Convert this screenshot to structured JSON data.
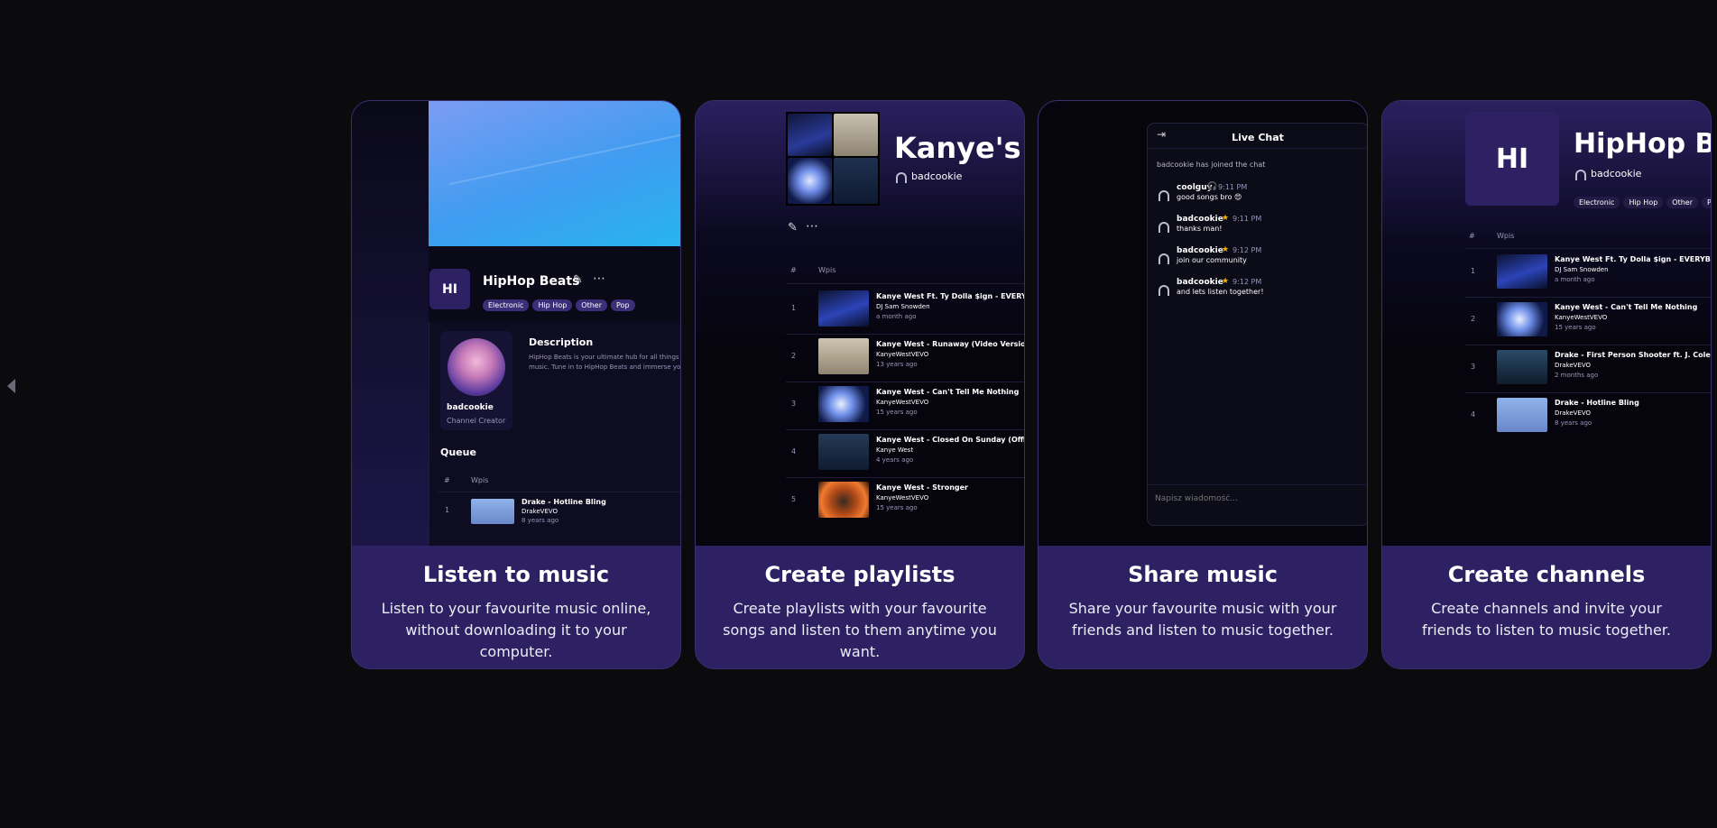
{
  "nav": {
    "prev_icon": "chevron-left-icon",
    "next_icon": "chevron-right-icon"
  },
  "cards": [
    {
      "title": "Listen to music",
      "text": "Listen to your favourite music online, without downloading it to your computer.",
      "preview": {
        "avatar_initials": "HI",
        "channel_name": "HipHop Beats",
        "tags": [
          "Electronic",
          "Hip Hop",
          "Other",
          "Pop"
        ],
        "creator_name": "badcookie",
        "creator_role": "Channel Creator",
        "description_heading": "Description",
        "description_text": "HipHop Beats is your ultimate hub for all things music. Tune in to HipHop Beats and immerse yo",
        "queue_heading": "Queue",
        "col_num": "#",
        "col_title": "Wpis",
        "queue": [
          {
            "num": "1",
            "title": "Drake - Hotline Bling",
            "artist": "DrakeVEVO",
            "age": "8 years ago"
          }
        ]
      }
    },
    {
      "title": "Create playlists",
      "text": "Create playlists with your favourite songs and listen to them anytime you want.",
      "preview": {
        "playlist_name": "Kanye's Be",
        "owner": "badcookie",
        "col_num": "#",
        "col_title": "Wpis",
        "tracks": [
          {
            "num": "1",
            "title": "Kanye West Ft. Ty Dolla $ign - EVERYB",
            "artist": "DJ Sam Snowden",
            "age": "a month ago"
          },
          {
            "num": "2",
            "title": "Kanye West - Runaway (Video Version",
            "artist": "KanyeWestVEVO",
            "age": "13 years ago"
          },
          {
            "num": "3",
            "title": "Kanye West - Can't Tell Me Nothing",
            "artist": "KanyeWestVEVO",
            "age": "15 years ago"
          },
          {
            "num": "4",
            "title": "Kanye West - Closed On Sunday (Offic",
            "artist": "Kanye West",
            "age": "4 years ago"
          },
          {
            "num": "5",
            "title": "Kanye West - Stronger",
            "artist": "KanyeWestVEVO",
            "age": "15 years ago"
          }
        ]
      }
    },
    {
      "title": "Share music",
      "text": "Share your favourite music with your friends and listen to music together.",
      "preview": {
        "chat_title": "Live Chat",
        "system_message": "badcookie has joined the chat",
        "messages": [
          {
            "user": "coolguy",
            "time": "9:11 PM",
            "text": "good songs bro 😍"
          },
          {
            "user": "badcookie",
            "time": "9:11 PM",
            "text": "thanks man!"
          },
          {
            "user": "badcookie",
            "time": "9:12 PM",
            "text": "join our community"
          },
          {
            "user": "badcookie",
            "time": "9:12 PM",
            "text": "and lets listen together!"
          }
        ],
        "input_placeholder": "Napisz wiadomość..."
      }
    },
    {
      "title": "Create channels",
      "text": "Create channels and invite your friends to listen to music together.",
      "preview": {
        "avatar_initials": "HI",
        "channel_name": "HipHop Be",
        "owner": "badcookie",
        "tags": [
          "Electronic",
          "Hip Hop",
          "Other",
          "Pop"
        ],
        "col_num": "#",
        "col_title": "Wpis",
        "tracks": [
          {
            "num": "1",
            "title": "Kanye West Ft. Ty Dolla $ign - EVERYBO",
            "artist": "DJ Sam Snowden",
            "age": "a month ago"
          },
          {
            "num": "2",
            "title": "Kanye West - Can't Tell Me Nothing",
            "artist": "KanyeWestVEVO",
            "age": "15 years ago"
          },
          {
            "num": "3",
            "title": "Drake - First Person Shooter ft. J. Cole",
            "artist": "DrakeVEVO",
            "age": "2 months ago"
          },
          {
            "num": "4",
            "title": "Drake - Hotline Bling",
            "artist": "DrakeVEVO",
            "age": "8 years ago"
          }
        ]
      }
    }
  ],
  "colors": {
    "card_bg": "#2d2163",
    "page_bg": "#0b0b0d",
    "tag_bg": "#3a2f78",
    "star": "#f5b400"
  }
}
